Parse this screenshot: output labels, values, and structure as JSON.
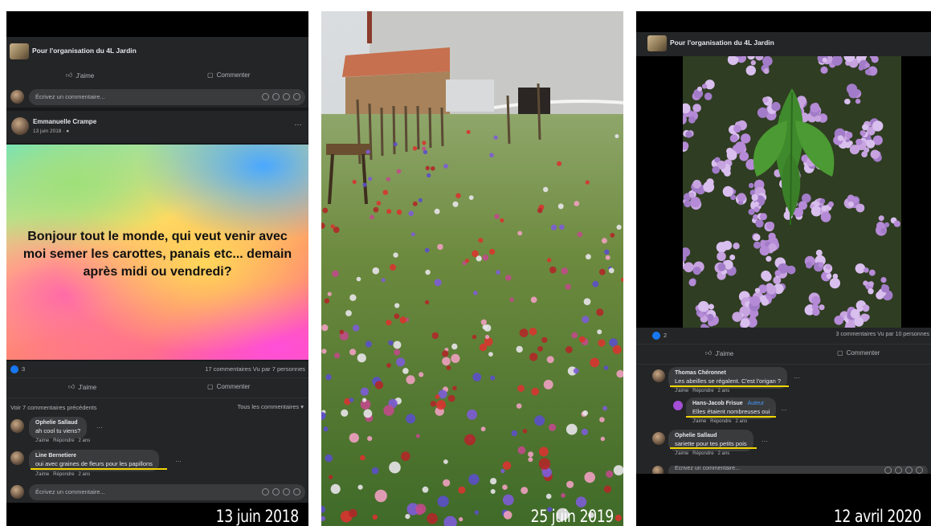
{
  "panel1": {
    "group_title": "Pour l'organisation du 4L Jardin",
    "like_label": "J'aime",
    "comment_label": "Commenter",
    "comment_placeholder": "Écrivez un commentaire...",
    "author": "Emmanuelle Crampe",
    "post_date": "13 juin 2018 · ",
    "post_text": "Bonjour tout le monde, qui veut venir avec moi semer les carottes, panais etc... demain après midi ou vendredi?",
    "reactions_count": "3",
    "stats": "17 commentaires  Vu par 7 personnes",
    "prev_comments": "Voir 7 commentaires précédents",
    "all_comments": "Tous les commentaires",
    "comments": [
      {
        "name": "Ophelie Sallaud",
        "text": "ah cool tu viens?",
        "like": "J'aime",
        "reply": "Répondre",
        "age": "2 ans"
      },
      {
        "name": "Line Bernetiere",
        "text": "oui avec graines de fleurs pour les papillons",
        "like": "J'aime",
        "reply": "Répondre",
        "age": "2 ans"
      }
    ],
    "caption": "13 juin 2018"
  },
  "panel2": {
    "caption": "25 juin 2019"
  },
  "panel3": {
    "group_title": "Pour l'organisation du 4L Jardin",
    "reactions_count": "2",
    "stats": "3 commentaires  Vu par 10 personnes",
    "like_label": "J'aime",
    "comment_label": "Commenter",
    "comments": [
      {
        "name": "Thomas Chéronnet",
        "text": "Les abeilles se régalent. C'est l'origan ?",
        "like": "J'aime",
        "reply": "Répondre",
        "age": "2 ans"
      },
      {
        "name": "Hans-Jacob Frisue",
        "badge": "Auteur",
        "text": "Elles étaient nombreuses oui",
        "like": "J'aime",
        "reply": "Répondre",
        "age": "2 ans"
      },
      {
        "name": "Ophelie Sallaud",
        "text": "sariette pour tes petits pois",
        "like": "J'aime",
        "reply": "Répondre",
        "age": "2 ans"
      }
    ],
    "comment_placeholder": "Écrivez un commentaire...",
    "caption": "12 avril 2020"
  },
  "colors": {
    "fb_dark": "#18191a",
    "fb_surface": "#242526",
    "fb_bubble": "#3a3b3c",
    "fb_blue": "#1877f2",
    "highlight": "#f2d600"
  }
}
